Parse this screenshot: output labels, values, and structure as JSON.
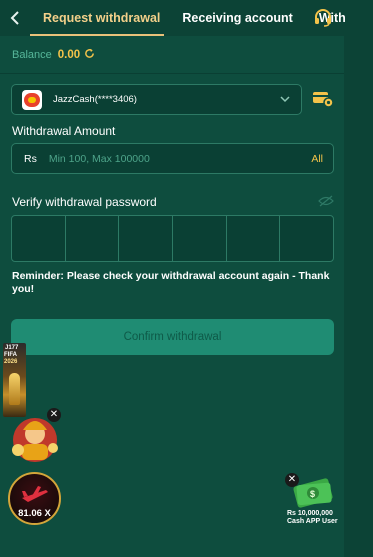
{
  "header": {
    "tabs": [
      {
        "label": "Request withdrawal",
        "active": true
      },
      {
        "label": "Receiving account",
        "active": false
      },
      {
        "label": "With",
        "active": false
      }
    ],
    "back_icon": "chevron-left-icon",
    "support_icon": "headset-icon"
  },
  "balance": {
    "label": "Balance",
    "value": "0.00",
    "refresh_icon": "refresh-icon"
  },
  "account": {
    "name": "JazzCash(****3406)",
    "logo_icon": "jazzcash-logo-icon",
    "manage_icon": "card-settings-icon"
  },
  "amount": {
    "label": "Withdrawal Amount",
    "currency": "Rs",
    "placeholder": "Min 100, Max 100000",
    "all_label": "All"
  },
  "password": {
    "label": "Verify withdrawal password",
    "cells": 6,
    "visibility_icon": "eye-closed-icon"
  },
  "reminder": "Reminder: Please check your withdrawal account again - Thank you!",
  "confirm_label": "Confirm withdrawal",
  "promos": {
    "fifa_line1": "J177",
    "fifa_line2": "FIFA",
    "fifa_line3": "2026",
    "aviator_multiplier": "81.06 X",
    "cash_line1": "Rs 10,000,000",
    "cash_line2": "Cash APP User",
    "close_glyph": "✕"
  },
  "colors": {
    "background": "#0e4d3e",
    "accent_gold": "#f3c34a",
    "active_tab": "#f3d08a",
    "button": "#1f8c73"
  }
}
